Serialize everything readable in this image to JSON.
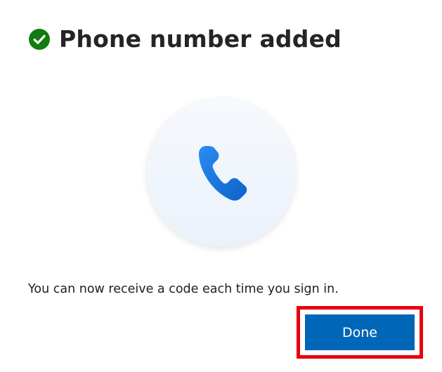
{
  "header": {
    "title": "Phone number added",
    "status_icon": "success-check-icon"
  },
  "illustration": {
    "icon": "phone-icon"
  },
  "message": {
    "text": "You can now receive a code each time you sign in."
  },
  "actions": {
    "done_label": "Done"
  },
  "colors": {
    "success": "#107c10",
    "accent": "#0067b8",
    "phone_icon": "#1a73d8",
    "highlight": "#e8000b"
  }
}
